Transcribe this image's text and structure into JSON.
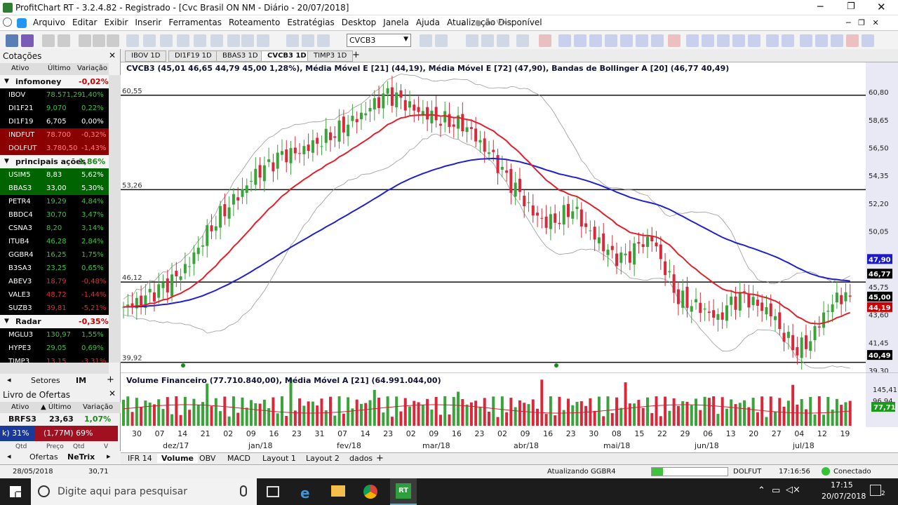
{
  "window": {
    "title": "ProfitChart RT - 3.2.4.82 - Registrado - [Cvc Brasil ON NM - Diário - 20/07/2018]"
  },
  "menu": [
    "Arquivo",
    "Editar",
    "Exibir",
    "Inserir",
    "Ferramentas",
    "Roteamento",
    "Estratégias",
    "Desktop",
    "Janela",
    "Ajuda",
    "Atualização Disponível"
  ],
  "live_label": "Ao Vivo",
  "ticker_input": "CVCB3",
  "cotacoes": {
    "title": "Cotações",
    "headers": [
      "Ativo",
      "Último",
      "Variação"
    ],
    "groups": [
      {
        "name": "infomoney",
        "var": "-0,02%",
        "rows": [
          {
            "a": "IBOV",
            "u": "78.571,29",
            "v": "1,40%",
            "bg": "#000",
            "c": "#3ec43e"
          },
          {
            "a": "DI1F21",
            "u": "9,070",
            "v": "0,22%",
            "bg": "#000",
            "c": "#3ec43e"
          },
          {
            "a": "DI1F19",
            "u": "6,705",
            "v": "0,00%",
            "bg": "#000",
            "c": "#fff"
          },
          {
            "a": "INDFUT",
            "u": "78.700",
            "v": "-0,32%",
            "bg": "#8b0000",
            "c": "#ff8080"
          },
          {
            "a": "DOLFUT",
            "u": "3.780,50",
            "v": "-1,43%",
            "bg": "#8b0000",
            "c": "#ff8080"
          }
        ]
      },
      {
        "name": "principais ações",
        "var": "1,86%",
        "rows": [
          {
            "a": "USIM5",
            "u": "8,83",
            "v": "5,62%",
            "bg": "#006400",
            "c": "#fff"
          },
          {
            "a": "BBAS3",
            "u": "33,00",
            "v": "5,30%",
            "bg": "#006400",
            "c": "#fff"
          },
          {
            "a": "PETR4",
            "u": "19,29",
            "v": "4,84%",
            "bg": "#000",
            "c": "#3ec43e"
          },
          {
            "a": "BBDC4",
            "u": "30,70",
            "v": "3,47%",
            "bg": "#000",
            "c": "#3ec43e"
          },
          {
            "a": "CSNA3",
            "u": "8,20",
            "v": "3,14%",
            "bg": "#000",
            "c": "#3ec43e"
          },
          {
            "a": "ITUB4",
            "u": "46,28",
            "v": "2,84%",
            "bg": "#000",
            "c": "#3ec43e"
          },
          {
            "a": "GGBR4",
            "u": "16,25",
            "v": "1,75%",
            "bg": "#000",
            "c": "#3ec43e"
          },
          {
            "a": "B3SA3",
            "u": "23,25",
            "v": "0,65%",
            "bg": "#000",
            "c": "#3ec43e"
          },
          {
            "a": "ABEV3",
            "u": "18,79",
            "v": "-0,48%",
            "bg": "#000",
            "c": "#e03030"
          },
          {
            "a": "VALE3",
            "u": "48,72",
            "v": "-1,44%",
            "bg": "#000",
            "c": "#e03030"
          },
          {
            "a": "SUZB3",
            "u": "39,81",
            "v": "-5,21%",
            "bg": "#000",
            "c": "#e03030"
          }
        ]
      },
      {
        "name": "Radar",
        "var": "-0,35%",
        "rows": [
          {
            "a": "MGLU3",
            "u": "130,97",
            "v": "1,55%",
            "bg": "#000",
            "c": "#3ec43e"
          },
          {
            "a": "HYPE3",
            "u": "29,05",
            "v": "0,69%",
            "bg": "#000",
            "c": "#3ec43e"
          },
          {
            "a": "TIMP3",
            "u": "13,15",
            "v": "-3,31%",
            "bg": "#000",
            "c": "#e03030"
          }
        ]
      }
    ],
    "bottom_tabs": [
      "Setores",
      "IM"
    ]
  },
  "livro": {
    "title": "Livro de Ofertas",
    "headers": [
      "Ativo",
      "Último",
      "Variação"
    ],
    "row": {
      "a": "BRFS3",
      "u": "23,63",
      "v": "1,07%"
    },
    "left_pct": "k) 31%",
    "right_pct": "(1,77M) 69%",
    "cols_partial": [
      "Qtd",
      "Preço",
      "Qtd",
      "V"
    ],
    "bottom_tabs": [
      "Ofertas",
      "NeTrix"
    ]
  },
  "chart_tabs": [
    "IBOV 1D",
    "DI1F19 1D",
    "BBAS3 1D",
    "CVCB3 1D",
    "TIMP3 1D"
  ],
  "legend_text": "CVCB3 (45,01  46,65  44,79  45,00  1,28%), Média Móvel E [21] (44,19), Média Móvel E [72] (47,90), Bandas de Bollinger A [20] (46,77  40,49)",
  "hlines": [
    "60,55",
    "53,26",
    "46,12",
    "39,92"
  ],
  "price_axis": [
    "60,80",
    "58,65",
    "56,50",
    "54,35",
    "52,20",
    "50,05",
    "47,90",
    "46,77",
    "45,75",
    "45,00",
    "44,19",
    "43,60",
    "41,45",
    "40,49",
    "39,30"
  ],
  "price_tags": [
    {
      "v": "47,90",
      "bg": "#1a1acc"
    },
    {
      "v": "46,77",
      "bg": "#000"
    },
    {
      "v": "45,00",
      "bg": "#000"
    },
    {
      "v": "44,19",
      "bg": "#cc0000"
    },
    {
      "v": "40,49",
      "bg": "#000"
    }
  ],
  "volume_legend": "Volume Financeiro (77.710.840,00), Média Móvel A [21] (64.991.044,00)",
  "volume_axis": [
    "145,41",
    "96,94"
  ],
  "volume_tag": "77,71",
  "date_days": [
    "30",
    "07",
    "14",
    "21",
    "02",
    "09",
    "16",
    "23",
    "31",
    "07",
    "14",
    "23",
    "02",
    "09",
    "16",
    "23",
    "02",
    "09",
    "16",
    "23",
    "30",
    "08",
    "15",
    "22",
    "29",
    "06",
    "13",
    "20",
    "27",
    "04",
    "12",
    "19"
  ],
  "date_months": [
    "dez/17",
    "jan/18",
    "fev/18",
    "mar/18",
    "abr/18",
    "mai/18",
    "jun/18",
    "jul/18"
  ],
  "bottom_tabs": [
    "IFR 14",
    "Volume",
    "OBV",
    "MACD",
    "Layout 1",
    "Layout 2",
    "dados"
  ],
  "status": {
    "date": "28/05/2018",
    "value": "30,71",
    "updating": "Atualizando GGBR4",
    "asset": "DOLFUT",
    "time": "17:16:56",
    "conn": "Conectado"
  },
  "taskbar": {
    "search": "Digite aqui para pesquisar",
    "time": "17:15",
    "date": "20/07/2018",
    "app": "RT",
    "notif": "2"
  },
  "colors": {
    "sma21": "#e0202a",
    "sma72": "#2020d0",
    "up": "#3aa43a",
    "down": "#d8283a",
    "band": "#999999"
  },
  "chart_data": {
    "type": "candlestick",
    "symbol": "CVCB3",
    "ohlc_last": {
      "open": 45.01,
      "high": 46.65,
      "low": 44.79,
      "close": 45.0,
      "change_pct": 1.28
    },
    "ma_e21": 44.19,
    "ma_e72": 47.9,
    "bb_upper": 46.77,
    "bb_lower": 40.49,
    "ylim": [
      38.6,
      62.0
    ],
    "sample_close": [
      44.2,
      44.5,
      45.0,
      45.6,
      46.4,
      47.6,
      49.5,
      51.0,
      52.2,
      53.2,
      54.4,
      55.0,
      55.8,
      56.0,
      56.6,
      57.2,
      57.8,
      58.5,
      59.0,
      59.8,
      60.5,
      60.0,
      59.4,
      59.1,
      58.8,
      58.6,
      58.2,
      56.8,
      55.6,
      54.0,
      52.8,
      51.4,
      50.8,
      51.2,
      52.0,
      50.4,
      49.2,
      48.0,
      47.8,
      48.9,
      49.5,
      47.2,
      45.0,
      44.6,
      44.0,
      43.2,
      44.4,
      44.9,
      44.2,
      43.8,
      42.1,
      41.0,
      41.8,
      43.6,
      44.8,
      45.0
    ]
  }
}
